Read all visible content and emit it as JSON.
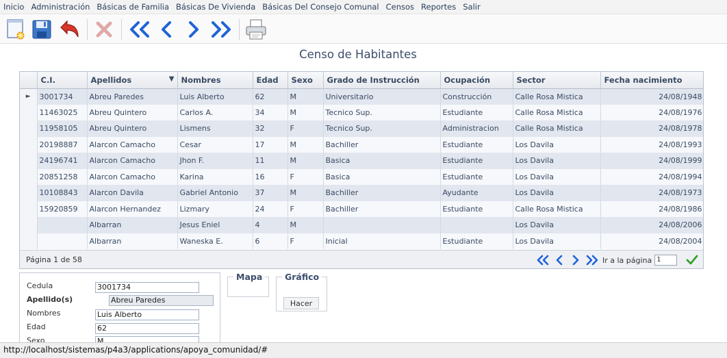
{
  "menu": [
    "Inicio",
    "Administración",
    "Básicas de Familia",
    "Básicas De Vivienda",
    "Básicas Del Consejo Comunal",
    "Censos",
    "Reportes",
    "Salir"
  ],
  "page_title": "Censo de Habitantes",
  "grid": {
    "columns": [
      "C.I.",
      "Apellidos",
      "Nombres",
      "Edad",
      "Sexo",
      "Grado de Instrucción",
      "Ocupación",
      "Sector",
      "Fecha nacimiento"
    ],
    "sorted_column": "Apellidos",
    "selected_row_marker": "►",
    "rows": [
      [
        "3001734",
        "Abreu Paredes",
        "Luis Alberto",
        "62",
        "M",
        "Universitario",
        "Construcción",
        "Calle Rosa Mistica",
        "24/08/1948"
      ],
      [
        "11463025",
        "Abreu Quintero",
        "Carlos A.",
        "34",
        "M",
        "Tecnico Sup.",
        "Estudiante",
        "Calle Rosa Mistica",
        "24/08/1976"
      ],
      [
        "11958105",
        "Abreu Quintero",
        "Lismens",
        "32",
        "F",
        "Tecnico Sup.",
        "Administracion",
        "Calle Rosa Mistica",
        "24/08/1978"
      ],
      [
        "20198887",
        "Alarcon Camacho",
        "Cesar",
        "17",
        "M",
        "Bachiller",
        "Estudiante",
        "Los Davila",
        "24/08/1993"
      ],
      [
        "24196741",
        "Alarcon Camacho",
        "Jhon F.",
        "11",
        "M",
        "Basica",
        "Estudiante",
        "Los Davila",
        "24/08/1999"
      ],
      [
        "20851258",
        "Alarcon Camacho",
        "Karina",
        "16",
        "F",
        "Basica",
        "Estudiante",
        "Los Davila",
        "24/08/1994"
      ],
      [
        "10108843",
        "Alarcon Davila",
        "Gabriel Antonio",
        "37",
        "M",
        "Bachiller",
        "Ayudante",
        "Los Davila",
        "24/08/1973"
      ],
      [
        "15920859",
        "Alarcon Hernandez",
        "Lizmary",
        "24",
        "F",
        "Bachiller",
        "Estudiante",
        "Calle Rosa Mistica",
        "24/08/1986"
      ],
      [
        "",
        "Albarran",
        "Jesus Eniel",
        "4",
        "M",
        "",
        "",
        "Los Davila",
        "24/08/2006"
      ],
      [
        "",
        "Albarran",
        "Waneska E.",
        "6",
        "F",
        "Inicial",
        "Estudiante",
        "Los Davila",
        "24/08/2004"
      ]
    ],
    "pager": {
      "page_info": "Página 1 de 58",
      "goto_label": "Ir a la página",
      "goto_value": "1"
    }
  },
  "detail": {
    "cedula_label": "Cedula",
    "cedula_value": "3001734",
    "apellidos_label": "Apellido(s)",
    "apellidos_value": "Abreu Paredes",
    "nombres_label": "Nombres",
    "nombres_value": "Luis Alberto",
    "edad_label": "Edad",
    "edad_value": "62",
    "sexo_label": "Sexo",
    "sexo_value": "M"
  },
  "mapa_legend": "Mapa",
  "grafico_legend": "Gráfico",
  "hacer_label": "Hacer",
  "status_url": "http://localhost/sistemas/p4a3/applications/apoya_comunidad/#",
  "icons": {
    "new": "new-document-icon",
    "save": "save-icon",
    "undo": "undo-icon",
    "delete": "delete-icon",
    "first": "first-page-icon",
    "prev": "previous-icon",
    "next": "next-icon",
    "last": "last-page-icon",
    "print": "print-icon"
  },
  "colors": {
    "accent_blue": "#1f63d6",
    "row_odd": "#e1e6ef",
    "row_even": "#f6f8fb",
    "delete_red": "#e0a8a8",
    "ok_green": "#36a12c"
  }
}
